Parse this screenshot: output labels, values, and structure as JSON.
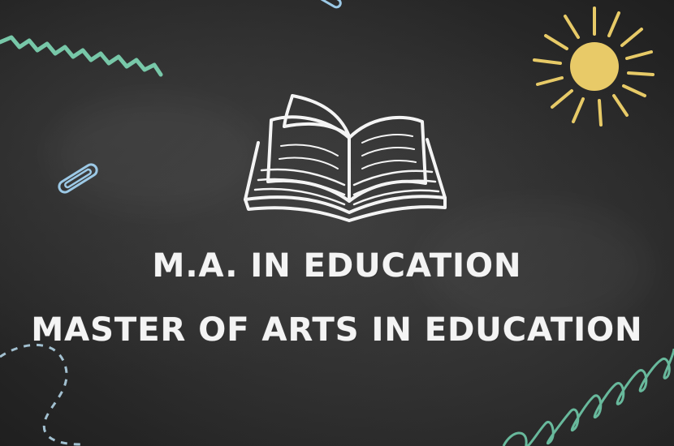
{
  "headline": {
    "abbreviation": "M.A. IN EDUCATION",
    "full_title": "MASTER OF ARTS IN EDUCATION"
  },
  "colors": {
    "chalkboard": "#2b2b2b",
    "chalk_white": "#f4f4f4",
    "sun_yellow": "#f2d36b",
    "zigzag_green": "#7fd8b6",
    "clip_blue": "#9cc9e6",
    "spring_green": "#6fc9a8"
  },
  "icons": [
    "open-book-icon",
    "sun-icon",
    "paperclip-icon",
    "zigzag-squiggle",
    "dashed-curve",
    "coil-spring"
  ]
}
